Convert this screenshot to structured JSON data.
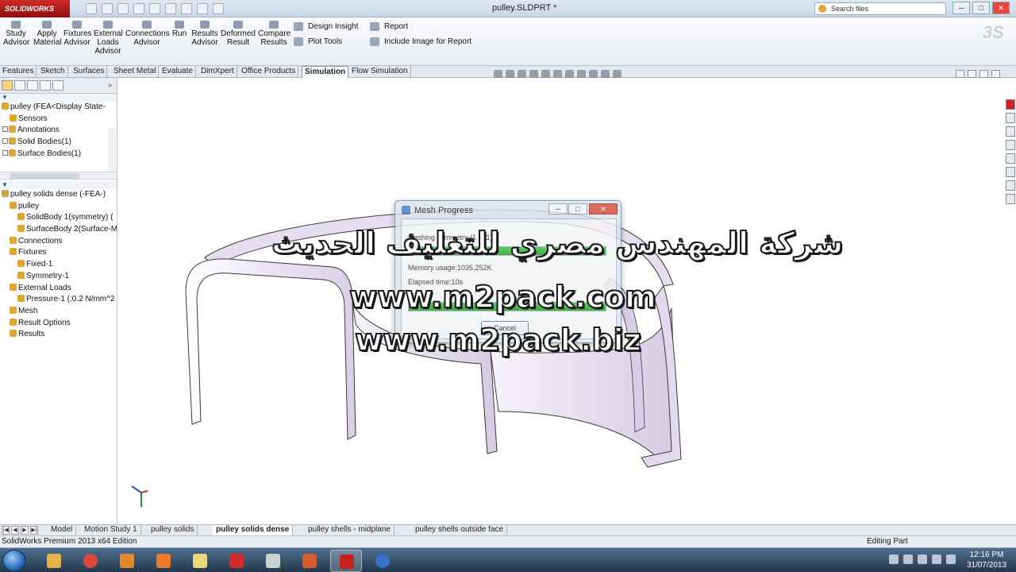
{
  "window": {
    "app_logo": "SOLIDWORKS",
    "doc_title": "pulley.SLDPRT *",
    "search_placeholder": "Search files",
    "btn_min": "─",
    "btn_max": "□",
    "btn_close": "✕"
  },
  "commands": {
    "study_advisor": "Study Advisor",
    "apply_material": "Apply Material",
    "fixtures_advisor": "Fixtures Advisor",
    "external_loads_advisor": "External Loads Advisor",
    "connections_advisor": "Connections Advisor",
    "run": "Run",
    "results_advisor": "Results Advisor",
    "deformed_result": "Deformed Result",
    "compare_results": "Compare Results",
    "design_insight": "Design Insight",
    "plot_tools": "Plot Tools",
    "report": "Report",
    "include_image": "Include Image for Report"
  },
  "tabs": [
    "Features",
    "Sketch",
    "Surfaces",
    "Sheet Metal",
    "Evaluate",
    "DimXpert",
    "Office Products",
    "Simulation",
    "Flow Simulation"
  ],
  "active_tab": "Simulation",
  "feature_tree": {
    "root": "pulley  (FEA<Display State-",
    "items": [
      "Sensors",
      "Annotations",
      "Solid Bodies(1)",
      "Surface Bodies(1)"
    ]
  },
  "study_tree": {
    "root": "pulley solids dense (-FEA-)",
    "items": [
      {
        "label": "pulley",
        "indent": 1
      },
      {
        "label": "SolidBody 1(symmetry) (",
        "indent": 2
      },
      {
        "label": "SurfaceBody 2(Surface-M",
        "indent": 2
      },
      {
        "label": "Connections",
        "indent": 1
      },
      {
        "label": "Fixtures",
        "indent": 1
      },
      {
        "label": "Fixed-1",
        "indent": 2
      },
      {
        "label": "Symmetry-1",
        "indent": 2
      },
      {
        "label": "External Loads",
        "indent": 1
      },
      {
        "label": "Pressure-1 (:0.2 N/mm^2",
        "indent": 2
      },
      {
        "label": "Mesh",
        "indent": 1
      },
      {
        "label": "Result Options",
        "indent": 1
      },
      {
        "label": "Results",
        "indent": 1
      }
    ]
  },
  "dialog": {
    "title": "Mesh Progress",
    "meshing_text": "Meshing symmetry (1 of 1)",
    "memory_text": "Memory usage:1035,252K",
    "elapsed_text": "Elapsed time:10s",
    "progress1": 1.0,
    "progress2": 1.0,
    "cancel": "Cancel"
  },
  "watermark": {
    "arabic": "شركة المهندس مصري للتغليف الحديث",
    "url1": "www.m2pack.com",
    "url2": "www.m2pack.biz"
  },
  "bottom_tabs": [
    "Model",
    "Motion Study 1",
    "pulley solids",
    "pulley solids dense",
    "pulley shells - midplane",
    "pulley shells outside face"
  ],
  "active_bottom_tab": "pulley solids dense",
  "status": {
    "left": "SolidWorks Premium 2013 x64 Edition",
    "right": "Editing Part"
  },
  "taskbar": {
    "time": "12:16 PM",
    "date": "31/07/2013"
  },
  "colors": {
    "progress_green": "#2eb02f",
    "part_fill": "#ece6f4",
    "part_edge": "#3a3a3a"
  }
}
